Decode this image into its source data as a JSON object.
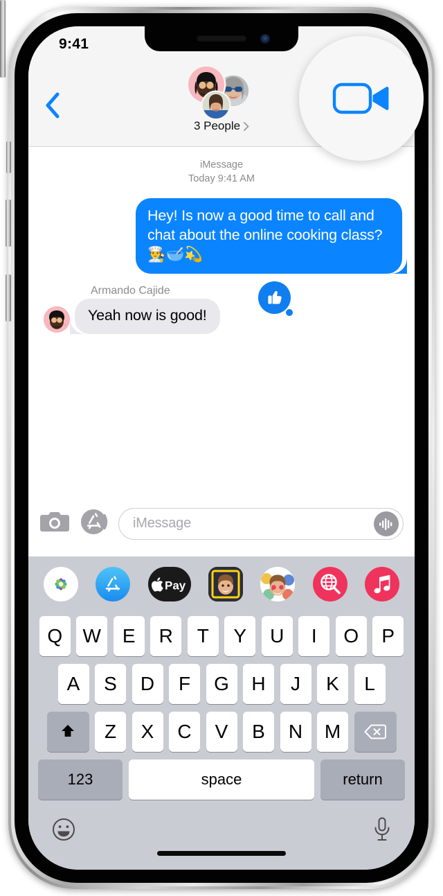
{
  "device": {
    "name": "iPhone",
    "hardware_buttons": [
      "mute-switch",
      "volume-up",
      "volume-down",
      "side-power"
    ]
  },
  "status_bar": {
    "time": "9:41"
  },
  "nav_bar": {
    "back_label": "Back",
    "back_icon": "chevron-left-icon",
    "participants_label": "3 People",
    "participants_chevron": "chevron-right-icon",
    "avatars": [
      {
        "name": "armando-cajide-memoji",
        "type": "memoji",
        "bg": "#f7b8be"
      },
      {
        "name": "contact-sunglasses-photo",
        "type": "photo"
      },
      {
        "name": "contact-woman-photo",
        "type": "photo"
      }
    ]
  },
  "callout": {
    "name": "facetime-video-button-magnifier",
    "icon": "video-camera-icon",
    "icon_color": "#0b84ff",
    "background": "#f7f7f7"
  },
  "conversation": {
    "service": "iMessage",
    "timestamp": "Today 9:41 AM",
    "messages": [
      {
        "direction": "outgoing",
        "text": "Hey! Is now a good time to call and chat about the online cooking class? 👨‍🍳🥣💫",
        "bubble_color": "#0b84ff",
        "text_color": "#ffffff"
      },
      {
        "direction": "incoming",
        "sender": "Armando Cajide",
        "text": "Yeah now is good!",
        "bubble_color": "#e8e8ed",
        "text_color": "#000000",
        "reaction": {
          "name": "thumbs-up-reaction",
          "icon": "👍",
          "color": "#107ef0"
        }
      }
    ]
  },
  "input_bar": {
    "camera_icon": "camera-icon",
    "apps_icon": "app-store-icon",
    "placeholder": "iMessage",
    "value": "",
    "audio_icon": "audio-waveform-icon"
  },
  "app_drawer": {
    "apps": [
      {
        "name": "photos-app",
        "label": "Photos"
      },
      {
        "name": "app-store-app",
        "label": "App Store"
      },
      {
        "name": "apple-pay-app",
        "label": "Apple Pay"
      },
      {
        "name": "memoji-app",
        "label": "Memoji"
      },
      {
        "name": "memoji-stickers-app",
        "label": "Memoji Stickers"
      },
      {
        "name": "images-gif-app",
        "label": "#images"
      },
      {
        "name": "apple-music-app",
        "label": "Music"
      }
    ]
  },
  "keyboard": {
    "row1": [
      "Q",
      "W",
      "E",
      "R",
      "T",
      "Y",
      "U",
      "I",
      "O",
      "P"
    ],
    "row2": [
      "A",
      "S",
      "D",
      "F",
      "G",
      "H",
      "J",
      "K",
      "L"
    ],
    "row3": [
      "Z",
      "X",
      "C",
      "V",
      "B",
      "N",
      "M"
    ],
    "shift_icon": "shift-arrow-icon",
    "delete_icon": "backspace-icon",
    "numbers_label": "123",
    "space_label": "space",
    "return_label": "return",
    "emoji_icon": "emoji-smiley-icon",
    "dictation_icon": "microphone-icon"
  },
  "colors": {
    "imessage_blue": "#0b84ff",
    "incoming_gray": "#e8e8ed",
    "keyboard_bg": "#c9ccd2",
    "nav_bg": "#f5f5f5"
  }
}
